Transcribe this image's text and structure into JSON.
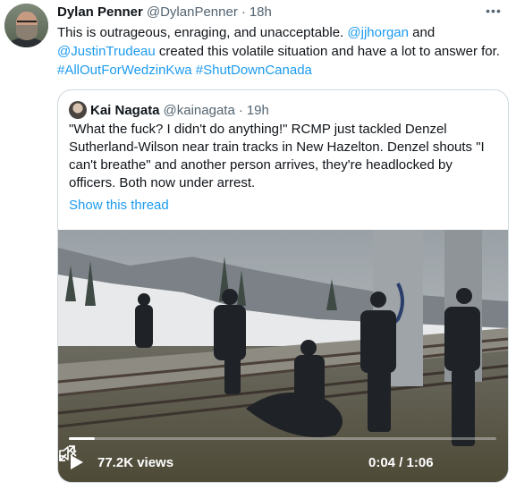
{
  "tweet": {
    "name": "Dylan Penner",
    "handle": "@DylanPenner",
    "separator": "·",
    "time": "18h",
    "more_label": "•••",
    "text_before": "This is outrageous, enraging, and unacceptable. ",
    "mention1": "@jjhorgan",
    "text_mid": " and ",
    "mention2": "@JustinTrudeau",
    "text_after": " created this volatile situation and have a lot to answer for. ",
    "hashtag1": "#AllOutForWedzinKwa",
    "hashtag2": "#ShutDownCanada"
  },
  "quote": {
    "name": "Kai Nagata",
    "handle": "@kainagata",
    "separator": "·",
    "time": "19h",
    "text": "\"What the fuck? I didn't do anything!\" RCMP just tackled Denzel Sutherland-Wilson near train tracks in New Hazelton. Denzel shouts \"I can't breathe\" and another person arrives, they're headlocked by officers. Both now under arrest.",
    "show_thread": "Show this thread"
  },
  "video": {
    "views": "77.2K views",
    "timecode": "0:04 / 1:06",
    "progress": 0.06,
    "icons": [
      "play-icon",
      "mute-icon",
      "fullscreen-icon"
    ]
  },
  "colors": {
    "link": "#1d9bf0",
    "secondary_text": "#536471",
    "border": "#cfd9de"
  }
}
